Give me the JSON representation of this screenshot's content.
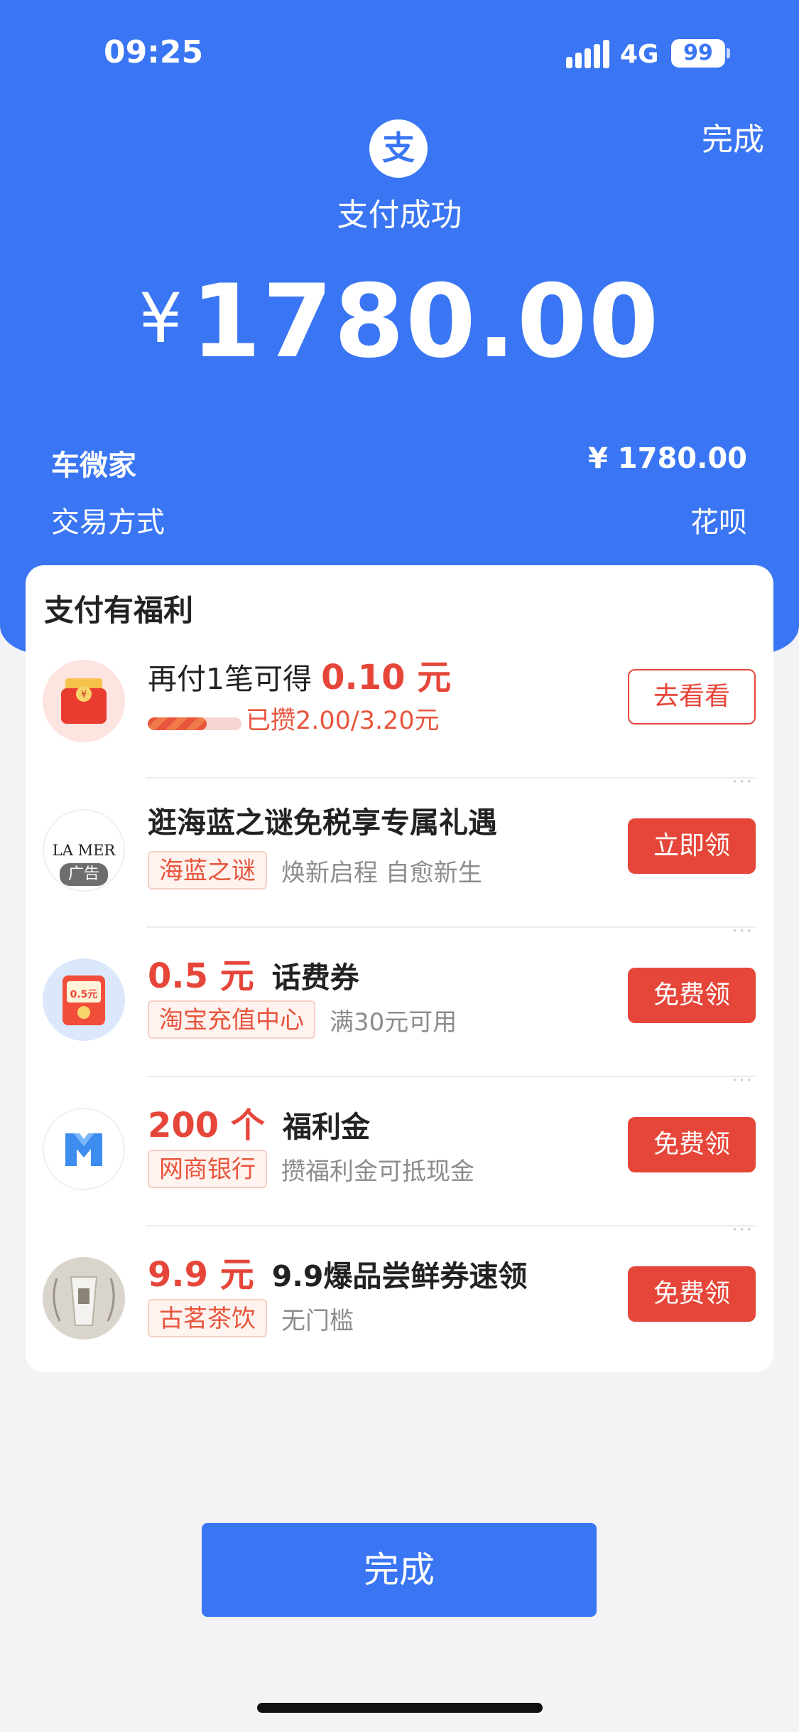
{
  "status_bar": {
    "time": "09:25",
    "network": "4G",
    "battery": "99"
  },
  "header": {
    "done_label": "完成",
    "logo_glyph": "支",
    "title": "支付成功",
    "currency": "¥",
    "amount": "1780.00",
    "merchant": "车微家",
    "merchant_amount": "¥ 1780.00",
    "payment_method_label": "交易方式",
    "payment_method": "花呗"
  },
  "card": {
    "title": "支付有福利",
    "reward": {
      "headline_prefix": "再付1笔可得",
      "headline_value": "0.10 元",
      "progress_text": "已攒2.00/3.20元",
      "progress_fraction": 0.625,
      "button": "去看看"
    },
    "items": [
      {
        "headline": "逛海蓝之谜免税享专属礼遇",
        "tag": "海蓝之谜",
        "subtext": "焕新启程 自愈新生",
        "button": "立即领",
        "logo_text": "LA MER",
        "ad_label": "广告"
      },
      {
        "headline_value": "0.5 元",
        "headline_text": "话费券",
        "tag": "淘宝充值中心",
        "subtext": "满30元可用",
        "button": "免费领",
        "thumb_text": "0.5元"
      },
      {
        "headline_value": "200 个",
        "headline_text": "福利金",
        "tag": "网商银行",
        "subtext": "攒福利金可抵现金",
        "button": "免费领"
      },
      {
        "headline_value": "9.9 元",
        "headline_text": "9.9爆品尝鲜券速领",
        "tag": "古茗茶饮",
        "subtext": "无门槛",
        "button": "免费领"
      }
    ]
  },
  "bottom": {
    "done_label": "完成"
  },
  "colors": {
    "brand_blue": "#3a76f3",
    "accent_red": "#e6463a",
    "background": "#f3f3f5"
  },
  "icons": [
    "alipay-logo-icon",
    "signal-icon",
    "battery-icon",
    "red-envelope-icon",
    "lamer-logo-icon",
    "phone-coupon-icon",
    "mybank-logo-icon",
    "tea-cup-icon"
  ]
}
